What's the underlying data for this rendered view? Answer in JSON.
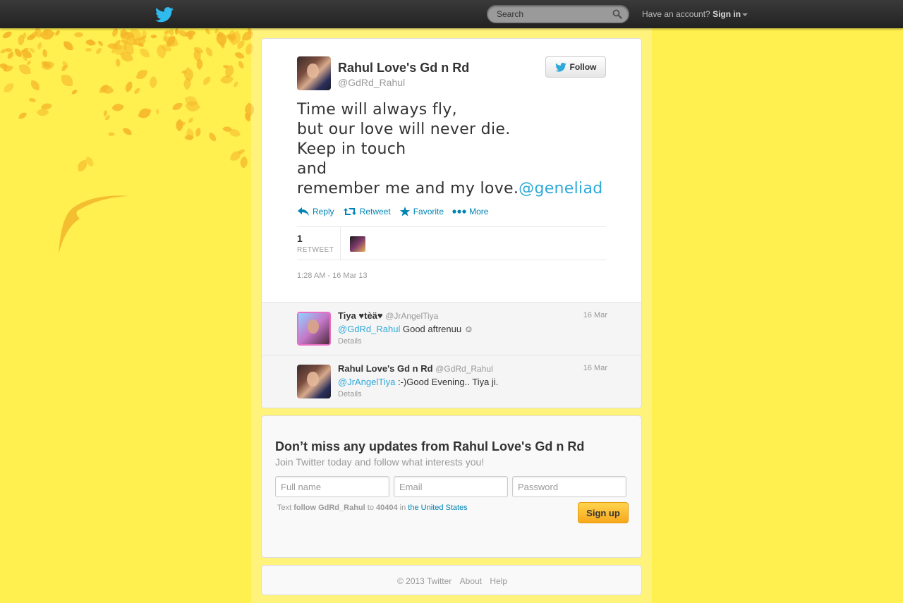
{
  "topbar": {
    "search_placeholder": "Search",
    "account_text": "Have an account?",
    "sign_in": "Sign in"
  },
  "profile": {
    "name": "Rahul Love's Gd n Rd",
    "handle": "@GdRd_Rahul",
    "follow_label": "Follow"
  },
  "tweet": {
    "lines": [
      "Time will always fly,",
      "but our love will never die.",
      "Keep in touch",
      "and",
      "remember me and my love."
    ],
    "mention": "@geneliad",
    "actions": {
      "reply": "Reply",
      "retweet": "Retweet",
      "favorite": "Favorite",
      "more": "More"
    },
    "retweet_count": "1",
    "retweet_label": "RETWEET",
    "timestamp": "1:28 AM - 16 Mar 13"
  },
  "replies": [
    {
      "name": "Tiya ♥tèä♥",
      "handle": "@JrAngelTiya",
      "date": "16 Mar",
      "mention": "@GdRd_Rahul",
      "text": " Good aftrenuu ☺",
      "details": "Details"
    },
    {
      "name": "Rahul Love's Gd n Rd",
      "handle": "@GdRd_Rahul",
      "date": "16 Mar",
      "mention": "@JrAngelTiya",
      "text": " :-)Good Evening.. Tiya ji.",
      "details": "Details"
    }
  ],
  "signup": {
    "title": "Don’t miss any updates from Rahul Love's Gd n Rd",
    "subtitle": "Join Twitter today and follow what interests you!",
    "full_name_placeholder": "Full name",
    "email_placeholder": "Email",
    "password_placeholder": "Password",
    "sms_prefix": "Text",
    "sms_command": "follow GdRd_Rahul",
    "sms_to": "to",
    "sms_number": "40404",
    "sms_in": "in",
    "sms_country": "the United States",
    "button": "Sign up"
  },
  "footer": {
    "copyright": "© 2013 Twitter",
    "about": "About",
    "help": "Help"
  },
  "colors": {
    "background": "#ffef4f",
    "link": "#0084b4",
    "mention": "#2fa9d9",
    "topbar": "#222222",
    "signup_button": "#f7a81c"
  }
}
